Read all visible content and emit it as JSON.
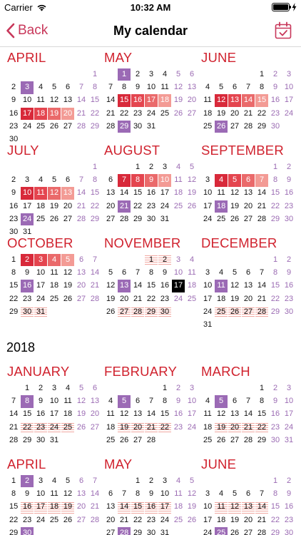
{
  "status": {
    "carrier": "Carrier",
    "time": "10:32 AM"
  },
  "nav": {
    "back_label": "Back",
    "title": "My calendar"
  },
  "icons": {
    "back": "chevron-left-icon",
    "calendar": "calendar-check-icon",
    "wifi": "wifi-icon",
    "battery": "battery-icon"
  },
  "colors": {
    "accent": "#c8375a",
    "month_title": "#d0222e",
    "weekend": "#9b6bb3",
    "today": "#9b6ab5",
    "period_dark": "#d8293a",
    "period_light": "#f39b95",
    "fertile_stripe": "#f1a7a0"
  },
  "years": [
    {
      "label": "",
      "months": [
        {
          "name": "APRIL",
          "first_weekday": 6,
          "days": 30,
          "today": [
            3
          ],
          "selected": [],
          "period": [
            [
              17,
              1
            ],
            [
              18,
              2
            ],
            [
              19,
              3
            ],
            [
              20,
              4
            ]
          ],
          "striped": []
        },
        {
          "name": "MAY",
          "first_weekday": 1,
          "days": 31,
          "today": [
            1,
            29
          ],
          "selected": [],
          "period": [
            [
              15,
              1
            ],
            [
              16,
              2
            ],
            [
              17,
              3
            ],
            [
              18,
              4
            ]
          ],
          "striped": []
        },
        {
          "name": "JUNE",
          "first_weekday": 4,
          "days": 30,
          "today": [
            26
          ],
          "selected": [],
          "period": [
            [
              12,
              1
            ],
            [
              13,
              2
            ],
            [
              14,
              3
            ],
            [
              15,
              4
            ]
          ],
          "striped": []
        },
        {
          "name": "JULY",
          "first_weekday": 6,
          "days": 31,
          "today": [
            24
          ],
          "selected": [],
          "period": [
            [
              10,
              1
            ],
            [
              11,
              2
            ],
            [
              12,
              3
            ],
            [
              13,
              4
            ]
          ],
          "striped": []
        },
        {
          "name": "AUGUST",
          "first_weekday": 2,
          "days": 31,
          "today": [
            21
          ],
          "selected": [],
          "period": [
            [
              7,
              1
            ],
            [
              8,
              2
            ],
            [
              9,
              3
            ],
            [
              10,
              4
            ]
          ],
          "striped": []
        },
        {
          "name": "SEPTEMBER",
          "first_weekday": 5,
          "days": 30,
          "today": [
            18
          ],
          "selected": [],
          "period": [
            [
              4,
              1
            ],
            [
              5,
              2
            ],
            [
              6,
              3
            ],
            [
              7,
              4
            ]
          ],
          "striped": []
        },
        {
          "name": "OCTOBER",
          "first_weekday": 0,
          "days": 31,
          "today": [
            16
          ],
          "selected": [],
          "period": [
            [
              2,
              1
            ],
            [
              3,
              2
            ],
            [
              4,
              3
            ],
            [
              5,
              4
            ]
          ],
          "striped": [
            30,
            31
          ]
        },
        {
          "name": "NOVEMBER",
          "first_weekday": 3,
          "days": 30,
          "today": [
            13
          ],
          "selected": [
            17
          ],
          "period": [],
          "striped": [
            1,
            2,
            27,
            28,
            29,
            30
          ]
        },
        {
          "name": "DECEMBER",
          "first_weekday": 5,
          "days": 31,
          "today": [
            11
          ],
          "selected": [],
          "period": [],
          "striped": [
            25,
            26,
            27,
            28
          ]
        }
      ]
    },
    {
      "label": "2018",
      "months": [
        {
          "name": "JANUARY",
          "first_weekday": 1,
          "days": 31,
          "today": [
            8
          ],
          "selected": [],
          "period": [],
          "striped": [
            22,
            23,
            24,
            25
          ]
        },
        {
          "name": "FEBRUARY",
          "first_weekday": 4,
          "days": 28,
          "today": [
            5
          ],
          "selected": [],
          "period": [],
          "striped": [
            19,
            20,
            21,
            22
          ]
        },
        {
          "name": "MARCH",
          "first_weekday": 4,
          "days": 31,
          "today": [
            5
          ],
          "selected": [],
          "period": [],
          "striped": [
            19,
            20,
            21,
            22
          ]
        },
        {
          "name": "APRIL",
          "first_weekday": 0,
          "days": 30,
          "today": [
            2,
            30
          ],
          "selected": [],
          "period": [],
          "striped": [
            16,
            17,
            18,
            19
          ]
        },
        {
          "name": "MAY",
          "first_weekday": 2,
          "days": 31,
          "today": [
            28
          ],
          "selected": [],
          "period": [],
          "striped": [
            14,
            15,
            16,
            17
          ]
        },
        {
          "name": "JUNE",
          "first_weekday": 5,
          "days": 30,
          "today": [
            25
          ],
          "selected": [],
          "period": [],
          "striped": [
            11,
            12,
            13,
            14
          ]
        }
      ]
    }
  ]
}
